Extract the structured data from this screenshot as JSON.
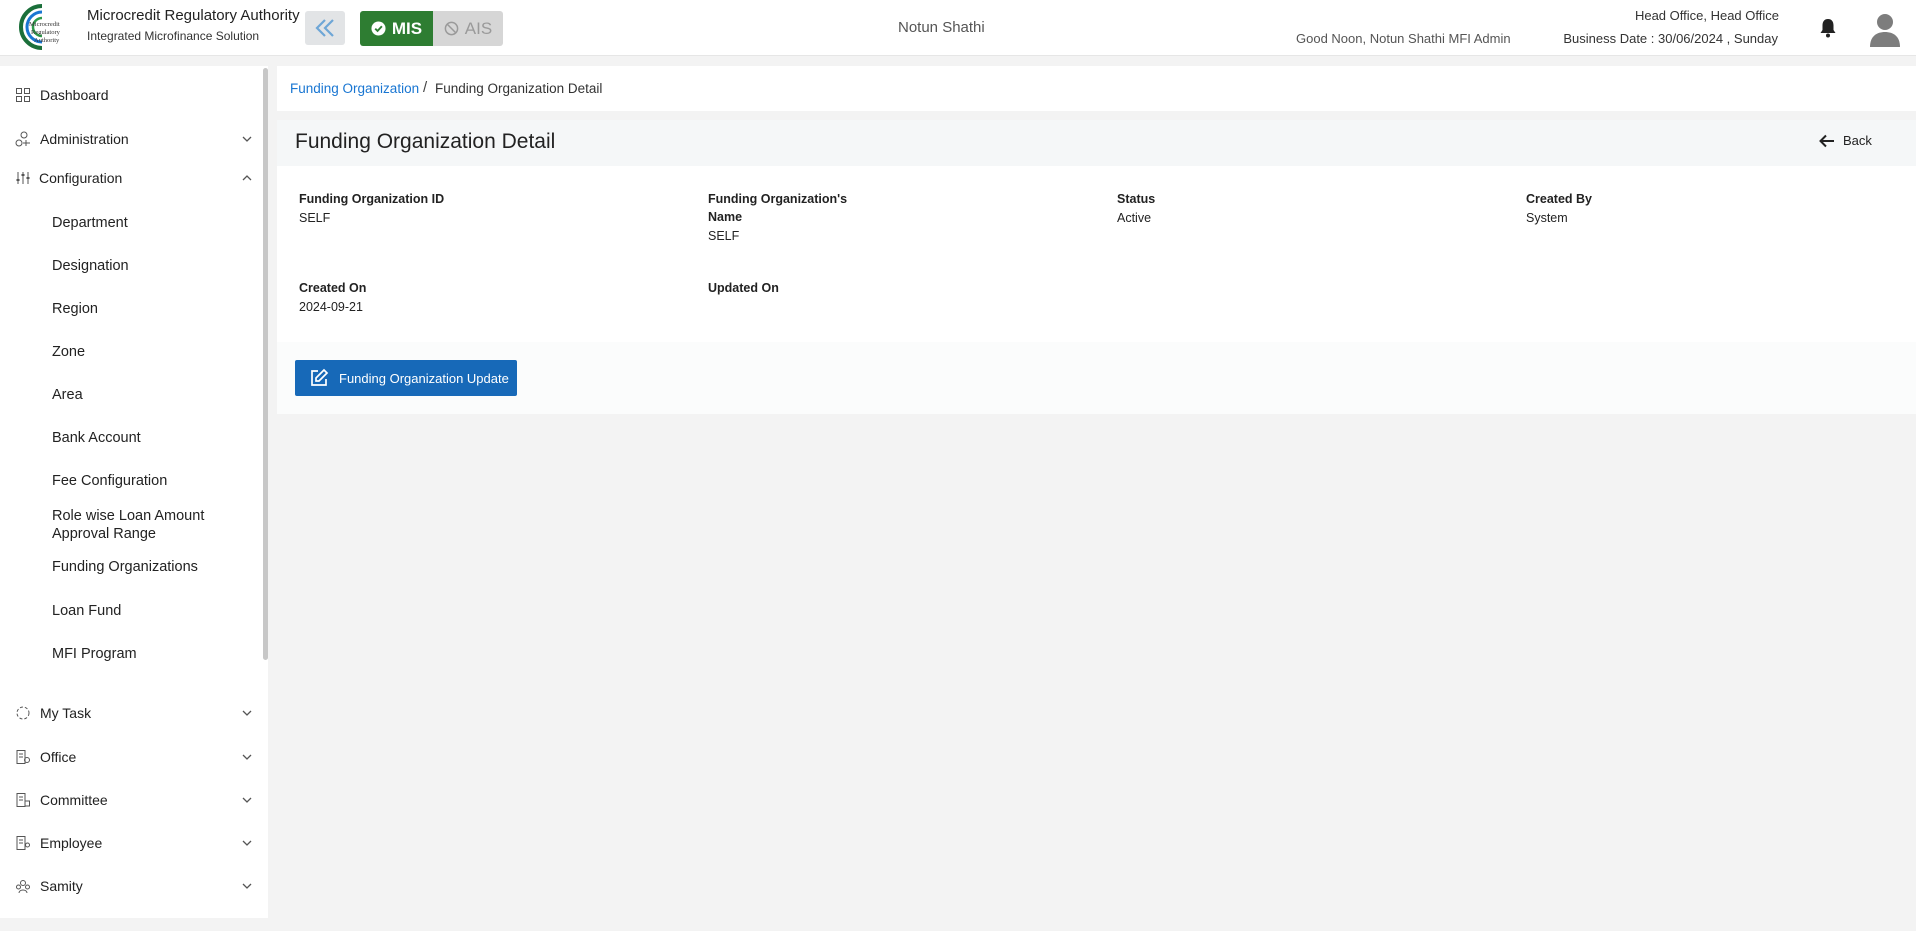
{
  "header": {
    "logo_text": "Microcredit Regulatory Authority",
    "brand_title": "Microcredit Regulatory Authority",
    "brand_subtitle": "Integrated Microfinance Solution",
    "mode_mis": "MIS",
    "mode_ais": "AIS",
    "organization": "Notun Shathi",
    "greeting": "Good Noon, Notun Shathi MFI Admin",
    "office": "Head Office, Head Office",
    "business_date": "Business Date : 30/06/2024 , Sunday"
  },
  "sidebar": {
    "items": [
      {
        "label": "Dashboard",
        "icon": "dashboard-icon"
      },
      {
        "label": "Administration",
        "icon": "administration-icon"
      },
      {
        "label": "Configuration",
        "icon": "configuration-icon"
      },
      {
        "label": "My Task",
        "icon": "task-icon"
      },
      {
        "label": "Office",
        "icon": "office-icon"
      },
      {
        "label": "Committee",
        "icon": "committee-icon"
      },
      {
        "label": "Employee",
        "icon": "employee-icon"
      },
      {
        "label": "Samity",
        "icon": "samity-icon"
      }
    ],
    "config_subitems": [
      "Department",
      "Designation",
      "Region",
      "Zone",
      "Area",
      "Bank Account",
      "Fee Configuration",
      "Role wise Loan Amount Approval Range",
      "Funding Organizations",
      "Loan Fund",
      "MFI Program"
    ]
  },
  "breadcrumb": {
    "parent": "Funding Organization",
    "separator": "/",
    "current": "Funding Organization Detail"
  },
  "detail": {
    "title": "Funding Organization Detail",
    "back_label": "Back",
    "fields": [
      {
        "label": "Funding Organization ID",
        "value": "SELF"
      },
      {
        "label": "Funding Organization's Name",
        "value": "SELF"
      },
      {
        "label": "Status",
        "value": "Active"
      },
      {
        "label": "Created By",
        "value": "System"
      },
      {
        "label": "Created On",
        "value": "2024-09-21"
      },
      {
        "label": "Updated On",
        "value": ""
      }
    ],
    "update_button": "Funding Organization Update"
  },
  "colors": {
    "accent": "#1769b8",
    "mis_active": "#2e7d32",
    "link": "#1976d2"
  }
}
